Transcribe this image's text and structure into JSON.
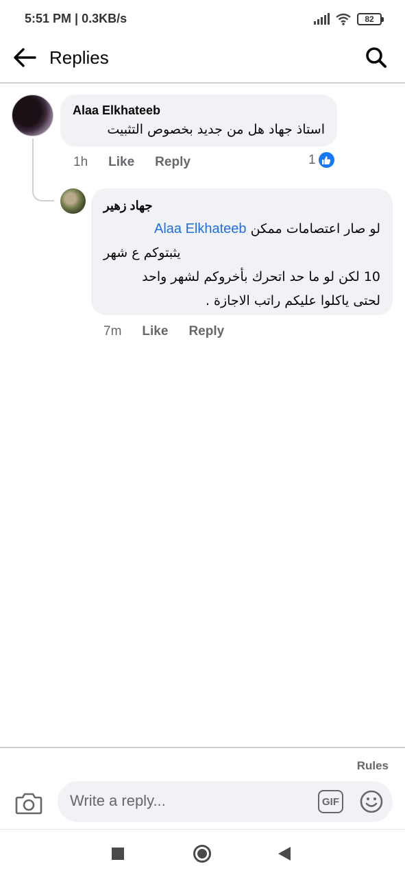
{
  "status_bar": {
    "time": "5:51 PM | 0.3KB/s",
    "battery": "82",
    "icons": [
      "signal-icon",
      "wifi-icon",
      "battery-icon"
    ]
  },
  "header": {
    "title": "Replies",
    "back_icon": "arrow-left-icon",
    "search_icon": "search-icon"
  },
  "comments": [
    {
      "author": "Alaa Elkhateeb",
      "text": "استاذ جهاد هل من جديد بخصوص التثبيت",
      "time": "1h",
      "like_label": "Like",
      "reply_label": "Reply",
      "reaction_count": "1",
      "reaction_icon": "thumbs-up-icon"
    }
  ],
  "reply": {
    "author": "جهاد زهير",
    "mention": "Alaa Elkhateeb",
    "line1": "لو صار اعتصامات ممكن",
    "line2": "يثبتوكم ع شهر",
    "line3": "10 لكن لو ما حد اتحرك بأخروكم لشهر واحد",
    "line4": "لحتى ياكلوا عليكم راتب الاجازة .",
    "time": "7m",
    "like_label": "Like",
    "reply_label": "Reply"
  },
  "composer": {
    "rules_label": "Rules",
    "placeholder": "Write a reply...",
    "gif_label": "GIF",
    "camera_icon": "camera-icon",
    "emoji_icon": "emoji-icon"
  },
  "colors": {
    "accent": "#1877f2",
    "mention": "#216fdb",
    "bubble": "#f0f2f5",
    "secondary_text": "#65676b"
  }
}
